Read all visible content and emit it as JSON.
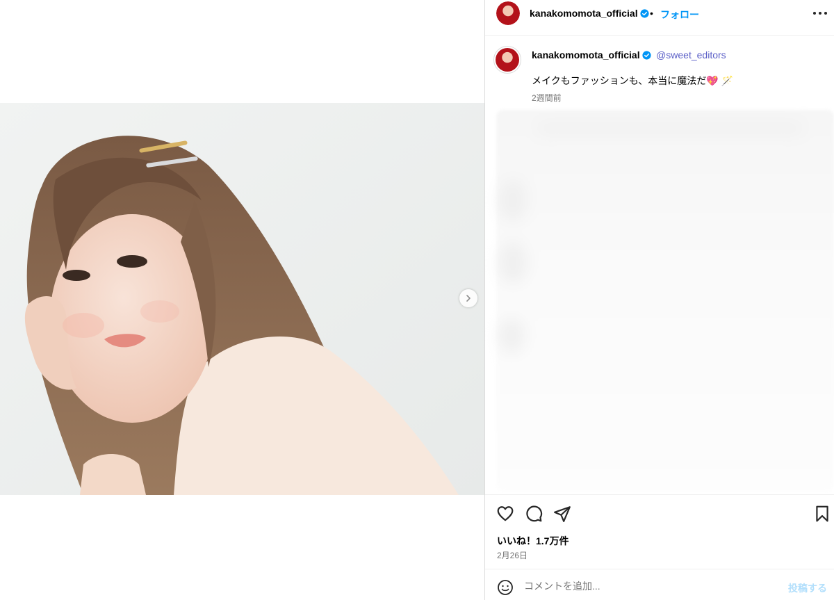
{
  "post": {
    "image_alt": "",
    "carousel_next_icon": "chevron-right-icon"
  },
  "header": {
    "username": "kanakomomota_official",
    "separator": "•",
    "follow_label": "フォロー",
    "more_icon": "more-horizontal-icon"
  },
  "caption": {
    "username": "kanakomomota_official",
    "mention": "@sweet_editors",
    "text": "メイクもファッションも、本当に魔法だ💖 🪄",
    "time_ago": "2週間前"
  },
  "actions": {
    "like_icon": "heart-icon",
    "comment_icon": "comment-icon",
    "share_icon": "share-icon",
    "save_icon": "bookmark-icon"
  },
  "likes_text": "いいね！1.7万件",
  "date": "2月26日",
  "comment": {
    "placeholder": "コメントを追加...",
    "post_label": "投稿する",
    "emoji_icon": "emoji-icon"
  },
  "colors": {
    "accent": "#0095f6",
    "mention": "#5b5fc7",
    "muted": "#737373",
    "verified": "#0095f6"
  }
}
